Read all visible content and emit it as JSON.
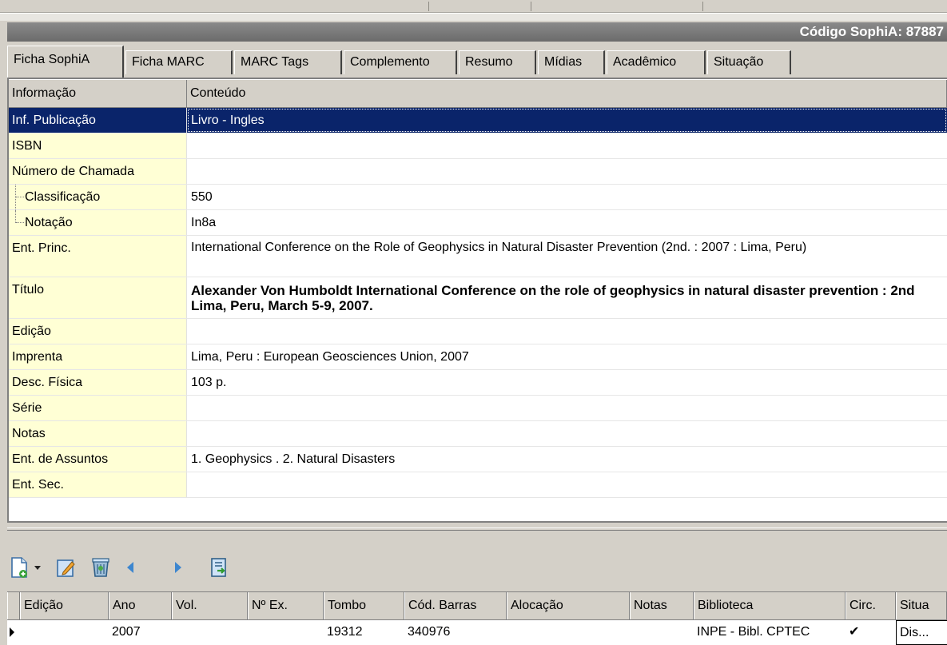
{
  "header": {
    "code_label": "Código SophiA: 87887"
  },
  "tabs": [
    {
      "label": "Ficha SophiA",
      "active": true
    },
    {
      "label": "Ficha MARC"
    },
    {
      "label": "MARC Tags"
    },
    {
      "label": "Complemento"
    },
    {
      "label": "Resumo"
    },
    {
      "label": "Mídias"
    },
    {
      "label": "Acadêmico"
    },
    {
      "label": "Situação"
    }
  ],
  "grid": {
    "col_info": "Informação",
    "col_content": "Conteúdo",
    "rows": [
      {
        "label": "Inf. Publicação",
        "value": "Livro - Ingles"
      },
      {
        "label": "ISBN",
        "value": ""
      },
      {
        "label": "Número de Chamada",
        "value": ""
      },
      {
        "label": "Classificação",
        "value": "550"
      },
      {
        "label": "Notação",
        "value": "In8a"
      },
      {
        "label": "Ent. Princ.",
        "value": "International Conference on the Role of Geophysics in Natural Disaster Prevention (2nd. : 2007 : Lima, Peru)"
      },
      {
        "label": "Título",
        "value": "Alexander Von Humboldt International Conference on the role of geophysics in natural disaster prevention : 2nd Lima, Peru, March 5-9, 2007."
      },
      {
        "label": "Edição",
        "value": ""
      },
      {
        "label": "Imprenta",
        "value": "Lima, Peru : European Geosciences Union, 2007"
      },
      {
        "label": "Desc. Física",
        "value": "103 p."
      },
      {
        "label": "Série",
        "value": ""
      },
      {
        "label": "Notas",
        "value": ""
      },
      {
        "label": "Ent. de Assuntos",
        "value": "1. Geophysics . 2. Natural Disasters"
      },
      {
        "label": "Ent. Sec.",
        "value": ""
      }
    ]
  },
  "toolbar": {
    "icons": [
      "new-document-icon",
      "dropdown-arrow-icon",
      "edit-icon",
      "delete-icon",
      "previous-icon",
      "next-icon",
      "export-icon"
    ]
  },
  "items_grid": {
    "headers": [
      "Edição",
      "Ano",
      "Vol.",
      "Nº Ex.",
      "Tombo",
      "Cód. Barras",
      "Alocação",
      "Notas",
      "Biblioteca",
      "Circ.",
      "Situa"
    ],
    "row": {
      "edicao": "",
      "ano": "2007",
      "vol": "",
      "nex": "",
      "tombo": "19312",
      "cod_barras": "340976",
      "alocacao": "",
      "notas": "",
      "biblioteca": "INPE - Bibl. CPTEC",
      "circ": "✔",
      "situacao": "Dis..."
    }
  }
}
